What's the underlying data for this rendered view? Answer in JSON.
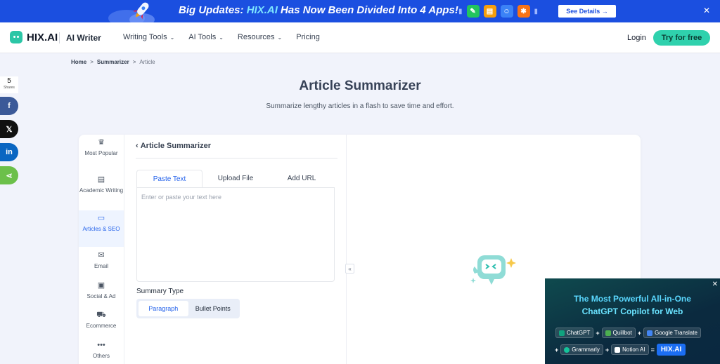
{
  "banner": {
    "headline_prefix": "Big Updates: ",
    "headline_highlight": "HIX.AI",
    "headline_suffix": " Has Now Been Divided Into 4 Apps!",
    "see_details": "See Details →",
    "close": "✕"
  },
  "nav": {
    "logo": "HIX.AI",
    "product": "AI Writer",
    "menu": [
      {
        "label": "Writing Tools",
        "has_dropdown": true
      },
      {
        "label": "AI Tools",
        "has_dropdown": true
      },
      {
        "label": "Resources",
        "has_dropdown": true
      },
      {
        "label": "Pricing",
        "has_dropdown": false
      }
    ],
    "login": "Login",
    "try_free": "Try for free"
  },
  "breadcrumb": {
    "home": "Home",
    "sep": ">",
    "section": "Summarizer",
    "current": "Article"
  },
  "share": {
    "count": "5",
    "label": "Shares",
    "buttons": [
      {
        "icon": "facebook-icon",
        "glyph": "f",
        "color": "#3b5998"
      },
      {
        "icon": "x-icon",
        "glyph": "𝕏",
        "color": "#111111"
      },
      {
        "icon": "linkedin-icon",
        "glyph": "in",
        "color": "#0a66c2"
      },
      {
        "icon": "share-icon",
        "glyph": "⋖",
        "color": "#6cc04a"
      }
    ]
  },
  "page": {
    "title": "Article Summarizer",
    "subtitle": "Summarize lengthy articles in a flash to save time and effort."
  },
  "categories": [
    {
      "label": "Most Popular",
      "icon": "crown-icon",
      "glyph": "♛",
      "active": false
    },
    {
      "label": "Academic Writing",
      "icon": "academic-icon",
      "glyph": "▤",
      "active": false
    },
    {
      "label": "Articles & SEO",
      "icon": "article-icon",
      "glyph": "▭",
      "active": true
    },
    {
      "label": "Email",
      "icon": "email-icon",
      "glyph": "✉",
      "active": false
    },
    {
      "label": "Social & Ad",
      "icon": "social-icon",
      "glyph": "▣",
      "active": false
    },
    {
      "label": "Ecommerce",
      "icon": "cart-icon",
      "glyph": "⛟",
      "active": false
    },
    {
      "label": "Others",
      "icon": "more-icon",
      "glyph": "•••",
      "active": false
    }
  ],
  "tool": {
    "back_label": "Article Summarizer",
    "tabs": [
      "Paste Text",
      "Upload File",
      "Add URL"
    ],
    "active_tab": 0,
    "placeholder": "Enter or paste your text here",
    "summary_type_label": "Summary Type",
    "summary_options": [
      "Paragraph",
      "Bullet Points"
    ],
    "active_summary": 0,
    "collapse": "«"
  },
  "ad": {
    "line1": "The Most Powerful All-in-One",
    "line2": "ChatGPT Copilot for Web",
    "close": "✕",
    "row1": [
      {
        "label": "ChatGPT",
        "color": "#10a37f"
      },
      {
        "op": "+"
      },
      {
        "label": "Quillbot",
        "color": "#4caf50"
      },
      {
        "op": "+"
      },
      {
        "label": "Google Translate",
        "color": "#4285f4"
      }
    ],
    "row2": [
      {
        "op": "+"
      },
      {
        "label": "Grammarly",
        "color": "#15c39a"
      },
      {
        "op": "+"
      },
      {
        "label": "Notion AI",
        "color": "#ffffff"
      },
      {
        "op": "="
      },
      {
        "brand": "HIX.AI"
      }
    ]
  },
  "colors": {
    "accent": "#2563eb",
    "brand": "#2fd1ad",
    "banner": "#1b4fe0"
  }
}
